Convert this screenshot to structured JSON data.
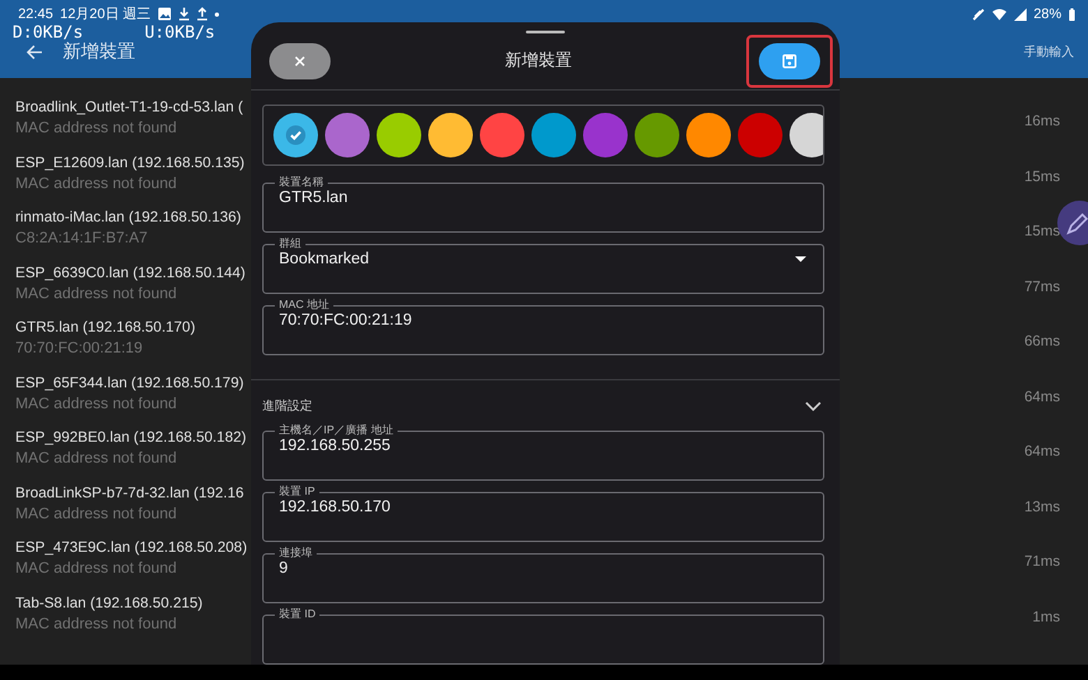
{
  "status_bar": {
    "time": "22:45",
    "date": "12月20日 週三",
    "battery": "28%",
    "download_speed": "D:0KB/s",
    "upload_speed": "U:0KB/s"
  },
  "app_bar": {
    "title": "新增裝置",
    "action": "手動輸入"
  },
  "devices": [
    {
      "name": "Broadlink_Outlet-T1-19-cd-53.lan (",
      "mac": "MAC address not found",
      "ping": "16ms"
    },
    {
      "name": "ESP_E12609.lan (192.168.50.135)",
      "mac": "MAC address not found",
      "ping": "15ms"
    },
    {
      "name": "rinmato-iMac.lan (192.168.50.136)",
      "mac": "C8:2A:14:1F:B7:A7",
      "ping": "15ms"
    },
    {
      "name": "ESP_6639C0.lan (192.168.50.144)",
      "mac": "MAC address not found",
      "ping": "77ms"
    },
    {
      "name": "GTR5.lan (192.168.50.170)",
      "mac": "70:70:FC:00:21:19",
      "ping": "66ms"
    },
    {
      "name": "ESP_65F344.lan (192.168.50.179)",
      "mac": "MAC address not found",
      "ping": "64ms"
    },
    {
      "name": "ESP_992BE0.lan (192.168.50.182)",
      "mac": "MAC address not found",
      "ping": "64ms"
    },
    {
      "name": "BroadLinkSP-b7-7d-32.lan (192.16",
      "mac": "MAC address not found",
      "ping": "13ms"
    },
    {
      "name": "ESP_473E9C.lan (192.168.50.208)",
      "mac": "MAC address not found",
      "ping": "71ms"
    },
    {
      "name": "Tab-S8.lan (192.168.50.215)",
      "mac": "MAC address not found",
      "ping": "1ms"
    }
  ],
  "sheet": {
    "title": "新增裝置",
    "save_highlighted": true,
    "colors": [
      {
        "color": "#3bb8e8",
        "selected": true
      },
      {
        "color": "#aa66cc",
        "selected": false
      },
      {
        "color": "#99cc00",
        "selected": false
      },
      {
        "color": "#ffbb33",
        "selected": false
      },
      {
        "color": "#ff4444",
        "selected": false
      },
      {
        "color": "#0099cc",
        "selected": false
      },
      {
        "color": "#9933cc",
        "selected": false
      },
      {
        "color": "#669900",
        "selected": false
      },
      {
        "color": "#ff8800",
        "selected": false
      },
      {
        "color": "#cc0000",
        "selected": false
      },
      {
        "color": "#d6d6d6",
        "selected": false
      }
    ],
    "fields": [
      {
        "kind": "text",
        "label": "裝置名稱",
        "value": "GTR5.lan"
      },
      {
        "kind": "dropdown",
        "label": "群組",
        "value": "Bookmarked"
      },
      {
        "kind": "text",
        "label": "MAC 地址",
        "value": "70:70:FC:00:21:19"
      }
    ],
    "advanced": {
      "title": "進階設定",
      "expanded": true,
      "fields": [
        {
          "kind": "text",
          "label": "主機名／IP／廣播 地址",
          "value": "192.168.50.255"
        },
        {
          "kind": "text",
          "label": "裝置 IP",
          "value": "192.168.50.170"
        },
        {
          "kind": "text",
          "label": "連接埠",
          "value": "9"
        },
        {
          "kind": "text",
          "label": "裝置 ID"
        }
      ]
    }
  }
}
